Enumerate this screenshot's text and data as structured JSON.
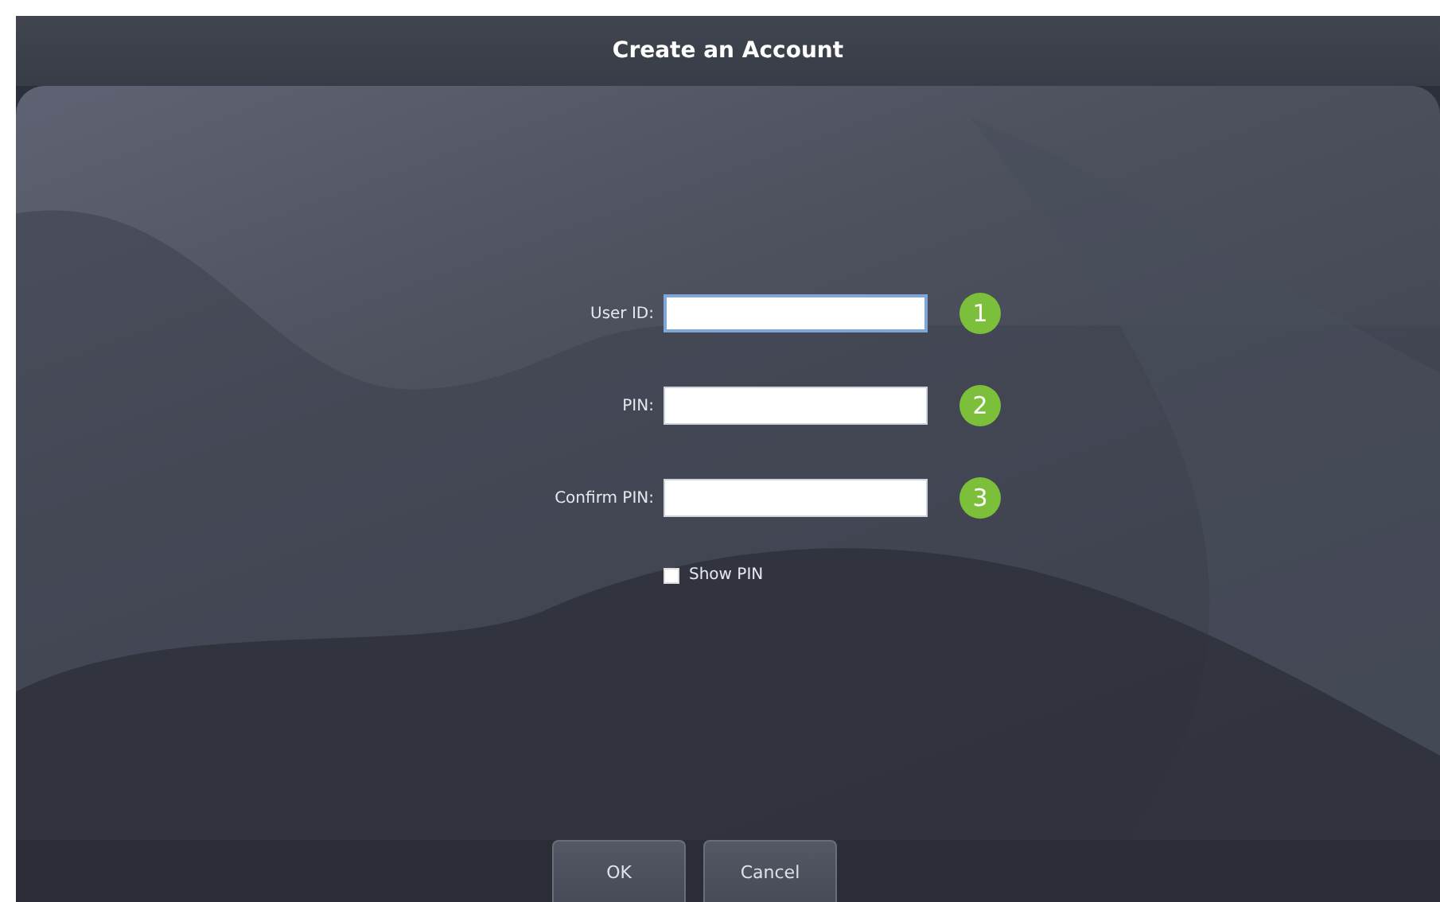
{
  "window": {
    "title": "Create an Account"
  },
  "fields": [
    {
      "label": "User ID:",
      "badge": "1",
      "focused": true
    },
    {
      "label": "PIN:",
      "badge": "2",
      "focused": false
    },
    {
      "label": "Confirm PIN:",
      "badge": "3",
      "focused": false
    }
  ],
  "show_pin": {
    "label": "Show PIN",
    "checked": false
  },
  "buttons": [
    "OK",
    "Cancel"
  ]
}
